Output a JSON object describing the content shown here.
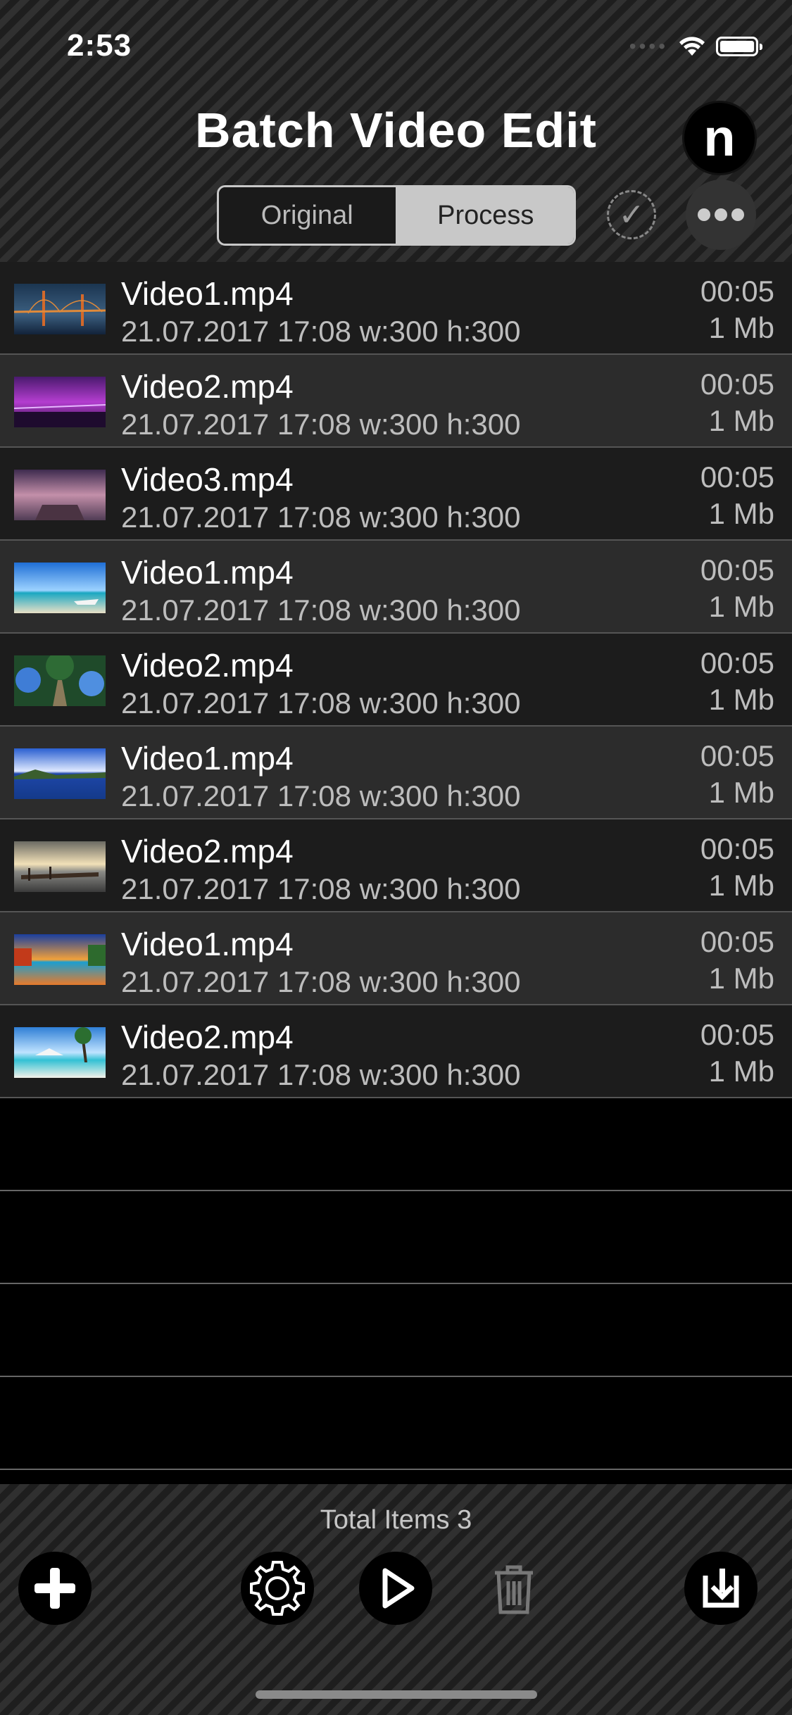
{
  "status": {
    "time": "2:53"
  },
  "header": {
    "title": "Batch Video Edit",
    "logo_letter": "n",
    "segments": {
      "original": "Original",
      "process": "Process",
      "selected": "Process"
    }
  },
  "videos": [
    {
      "name": "Video1.mp4",
      "meta": "21.07.2017 17:08 w:300 h:300",
      "duration": "00:05",
      "size": "1 Mb"
    },
    {
      "name": "Video2.mp4",
      "meta": "21.07.2017 17:08 w:300 h:300",
      "duration": "00:05",
      "size": "1 Mb"
    },
    {
      "name": "Video3.mp4",
      "meta": "21.07.2017 17:08 w:300 h:300",
      "duration": "00:05",
      "size": "1 Mb"
    },
    {
      "name": "Video1.mp4",
      "meta": "21.07.2017 17:08 w:300 h:300",
      "duration": "00:05",
      "size": "1 Mb"
    },
    {
      "name": "Video2.mp4",
      "meta": "21.07.2017 17:08 w:300 h:300",
      "duration": "00:05",
      "size": "1 Mb"
    },
    {
      "name": "Video1.mp4",
      "meta": "21.07.2017 17:08 w:300 h:300",
      "duration": "00:05",
      "size": "1 Mb"
    },
    {
      "name": "Video2.mp4",
      "meta": "21.07.2017 17:08 w:300 h:300",
      "duration": "00:05",
      "size": "1 Mb"
    },
    {
      "name": "Video1.mp4",
      "meta": "21.07.2017 17:08 w:300 h:300",
      "duration": "00:05",
      "size": "1 Mb"
    },
    {
      "name": "Video2.mp4",
      "meta": "21.07.2017 17:08 w:300 h:300",
      "duration": "00:05",
      "size": "1 Mb"
    }
  ],
  "footer": {
    "total_items": "Total Items 3"
  },
  "colors": {
    "background": "#000000",
    "row_odd": "#1c1c1c",
    "row_even": "#2c2c2c",
    "segment_active": "#c8c8c8"
  }
}
